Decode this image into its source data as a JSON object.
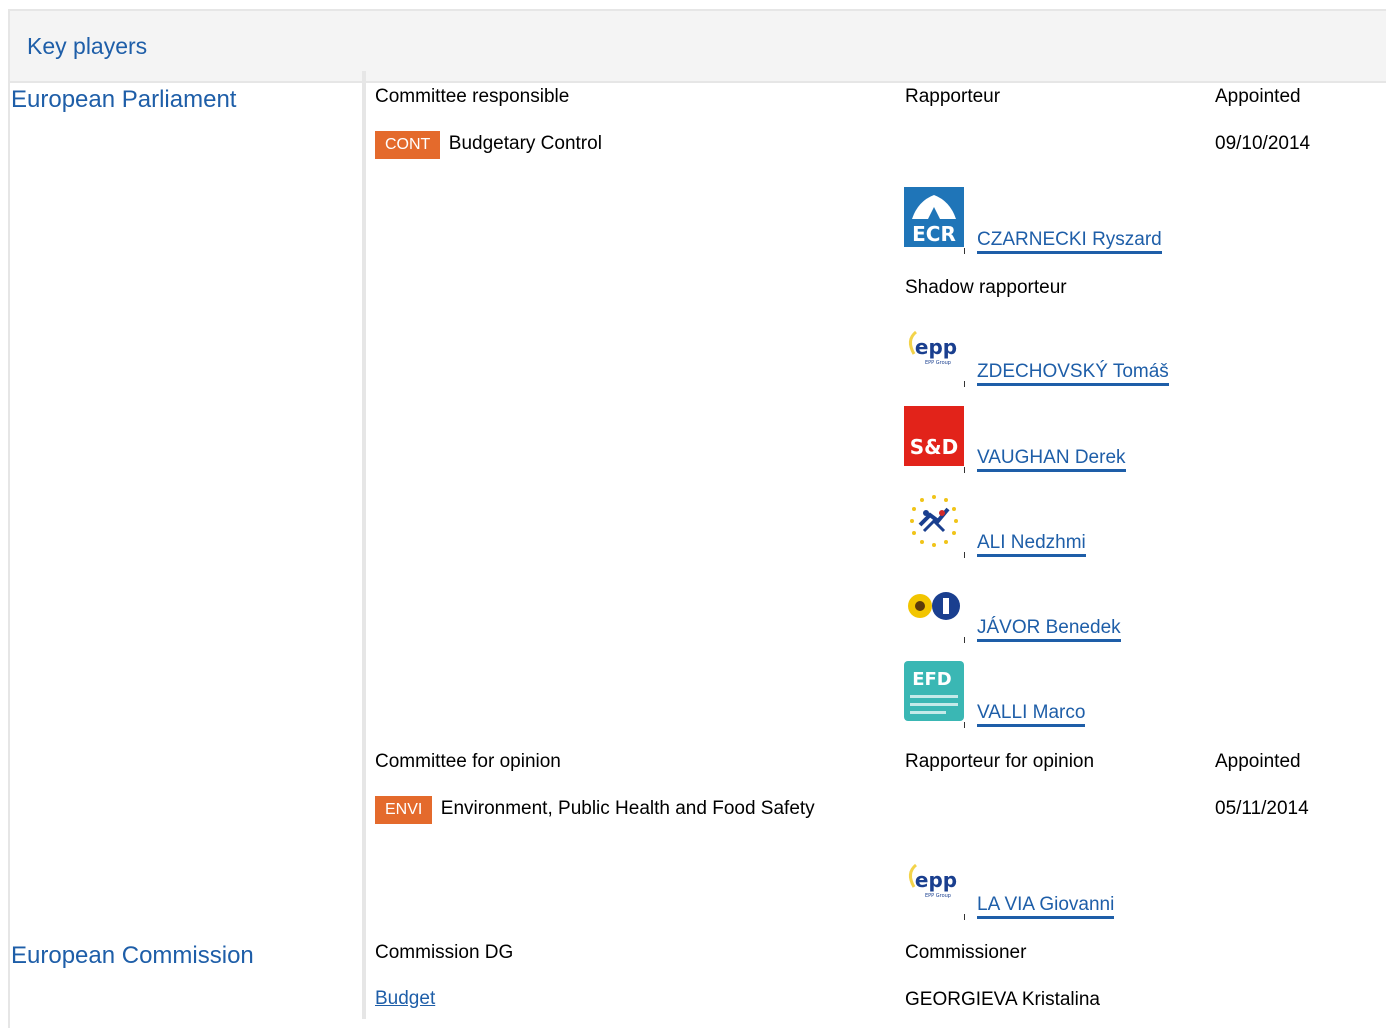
{
  "header": {
    "title": "Key players"
  },
  "ep": {
    "title": "European Parliament",
    "responsible": {
      "committee_label": "Committee responsible",
      "rapporteur_label": "Rapporteur",
      "appointed_label": "Appointed",
      "committee_code": "CONT",
      "committee_name": "Budgetary Control",
      "appointed_date": "09/10/2014",
      "rapporteur": {
        "group_logo": "ECR",
        "name": "CZARNECKI Ryszard"
      },
      "shadow_label": "Shadow rapporteur",
      "shadows": [
        {
          "group_logo": "epp",
          "name": "ZDECHOVSKÝ Tomáš"
        },
        {
          "group_logo": "S&D",
          "name": "VAUGHAN Derek"
        },
        {
          "group_logo": "alde-icon",
          "name": "ALI Nedzhmi"
        },
        {
          "group_logo": "greens-icon",
          "name": "JÁVOR Benedek"
        },
        {
          "group_logo": "EFD",
          "name": "VALLI Marco"
        }
      ]
    },
    "opinion": {
      "committee_label": "Committee for opinion",
      "rapporteur_label": "Rapporteur for opinion",
      "appointed_label": "Appointed",
      "committee_code": "ENVI",
      "committee_name": "Environment, Public Health and Food Safety",
      "appointed_date": "05/11/2014",
      "rapporteur": {
        "group_logo": "epp",
        "name": "LA VIA Giovanni"
      }
    }
  },
  "ec": {
    "title": "European Commission",
    "dg_label": "Commission DG",
    "commissioner_label": "Commissioner",
    "dg_name": "Budget",
    "commissioner_name": "GEORGIEVA Kristalina"
  },
  "colors": {
    "link": "#1e5ea8",
    "badge": "#e46a2c"
  }
}
